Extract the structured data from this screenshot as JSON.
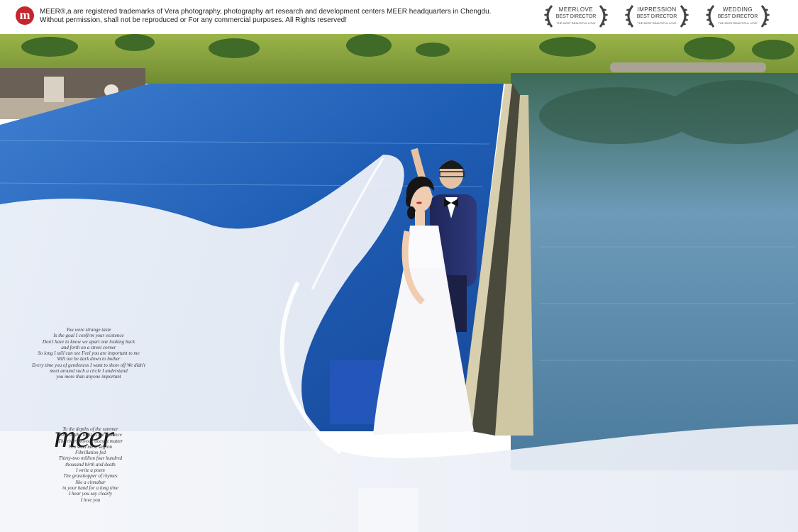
{
  "header": {
    "logo_letter": "m",
    "notice_line1": "MEER®,a are registered trademarks of Vera photography, photography art research and development centers MEER headquarters in Chengdu.",
    "notice_line2": "Without permission, shall not be reproduced or For any commercial purposes. All Rights reserved!",
    "awards": [
      {
        "title": "MEERLOVE",
        "subtitle": "BEST DIRECTOR",
        "tagline": "THE MOST BEAUTIFUL LOVE"
      },
      {
        "title": "IMPRESSION",
        "subtitle": "BEST DIRECTOR",
        "tagline": "THE MOST BEAUTIFUL LOVE"
      },
      {
        "title": "WEDDING",
        "subtitle": "BEST DIRECTOR",
        "tagline": "THE MOST BEAUTIFUL LOVE"
      }
    ]
  },
  "overlay": {
    "brand": "meer",
    "poem_top": [
      "You were strange taste",
      "Is the goal I confirm your existence",
      "Don't have to know we apart one looking back",
      "and forth on a street corner",
      "So long I still can see Feel you are important to me",
      "Will not be dark down to bother",
      "Every time you of gentleness I want to show off We didn't",
      "meet around such a circle I understand",
      "you more than anyone important"
    ],
    "poem_bottom": [
      "To the depths of the summer",
      "To send the light in the distance",
      "The river blows it doesn't matter",
      "You send me a saffron",
      "Fibrillation fed",
      "Thirty-two million four hundred",
      "thousand birth and death",
      "I write a poem",
      "The grasshopper of rhymes",
      "like a cinnabar",
      "in your hand for a long time",
      "I hear you say clearly",
      "I love you"
    ]
  },
  "colors": {
    "brand_red": "#c4262e",
    "pool_blue": "#1f5fb4",
    "lake_blue": "#5a87a8",
    "grass_green": "#7f9a3a"
  }
}
